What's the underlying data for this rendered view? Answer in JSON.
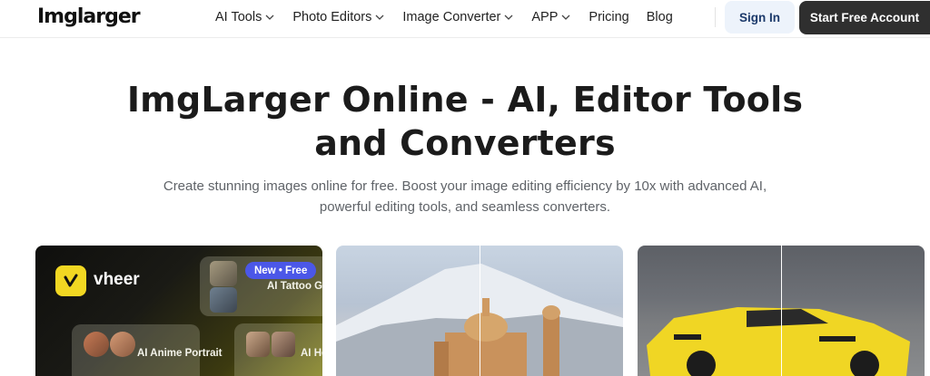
{
  "brand": {
    "name": "Imglarger"
  },
  "nav": {
    "items": [
      {
        "label": "AI Tools",
        "has_dropdown": true
      },
      {
        "label": "Photo Editors",
        "has_dropdown": true
      },
      {
        "label": "Image Converter",
        "has_dropdown": true
      },
      {
        "label": "APP",
        "has_dropdown": true
      },
      {
        "label": "Pricing",
        "has_dropdown": false
      },
      {
        "label": "Blog",
        "has_dropdown": false
      }
    ],
    "signin_label": "Sign In",
    "start_label": "Start Free Account"
  },
  "hero": {
    "title_line1": "ImgLarger Online - AI, Editor Tools",
    "title_line2": "and Converters",
    "subtitle_line1": "Create stunning images online for free. Boost your image editing efficiency by 10x with advanced AI,",
    "subtitle_line2": "powerful editing tools, and seamless converters."
  },
  "cards": {
    "vheer": {
      "brand": "vheer",
      "badge": "New • Free",
      "tile_labels": [
        "AI Tattoo Ge",
        "AI Anime Portrait",
        "AI He"
      ]
    }
  },
  "colors": {
    "brand_dark": "#2f2f2f",
    "signin_bg": "#edf3fb",
    "badge": "#4b57e8",
    "vheer_yellow": "#f1d722"
  }
}
